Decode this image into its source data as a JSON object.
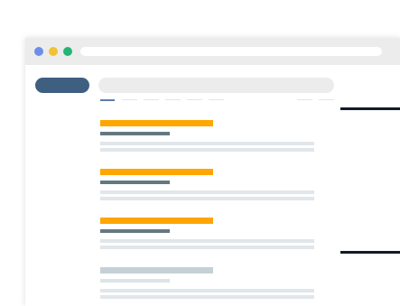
{
  "colors": {
    "window_dots": [
      "#6d8ee8",
      "#f2c231",
      "#22b573"
    ],
    "logo": "#3f5f80",
    "search_bar": "#ececec",
    "active_tab": "#5b7fa6",
    "result_title": "#ffa600",
    "result_title_muted": "#c5d1d6",
    "result_url": "#647880",
    "result_url_muted": "#dde4e7",
    "snippet_line": "#e1e6ea",
    "pointer_line": "#0f1b2a"
  },
  "icons": {
    "window_controls": [
      "close-dot-icon",
      "minimize-dot-icon",
      "maximize-dot-icon"
    ]
  },
  "search_tabs": [
    "tab-1",
    "tab-2",
    "tab-3",
    "tab-4",
    "tab-5",
    "tab-6",
    "tab-7"
  ],
  "results": [
    {
      "state": "highlighted"
    },
    {
      "state": "highlighted"
    },
    {
      "state": "highlighted"
    },
    {
      "state": "muted"
    }
  ]
}
